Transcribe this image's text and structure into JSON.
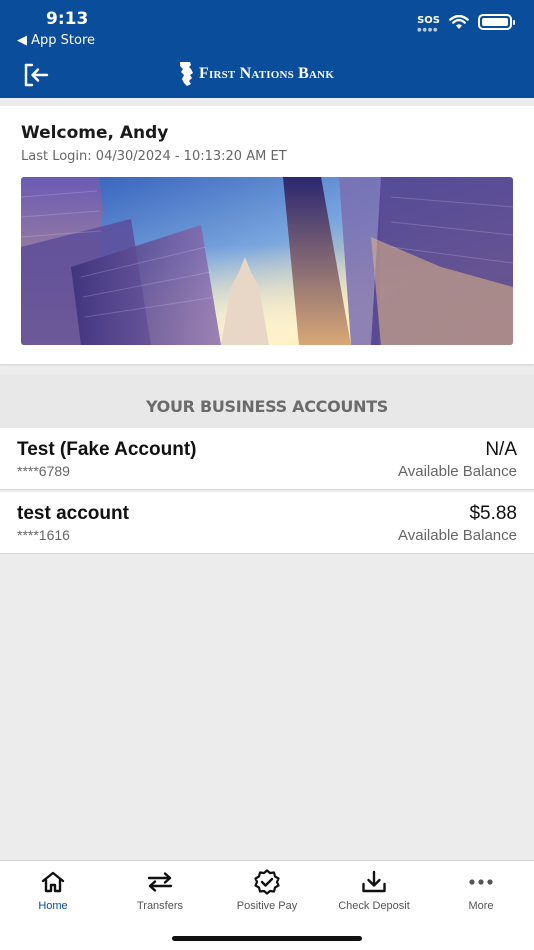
{
  "status_bar": {
    "time": "9:13",
    "back_app": "◀ App Store",
    "sos": "SOS"
  },
  "header": {
    "brand_name": "First Nations Bank",
    "logout_icon": "logout-icon",
    "brand_color": "#0a4e9b"
  },
  "welcome": {
    "title": "Welcome, Andy",
    "last_login": "Last Login: 04/30/2024 - 10:13:20 AM ET"
  },
  "accounts": {
    "section_title": "YOUR BUSINESS ACCOUNTS",
    "items": [
      {
        "name": "Test (Fake Account)",
        "number": "****6789",
        "balance": "N/A",
        "balance_label": "Available Balance"
      },
      {
        "name": "test account",
        "number": "****1616",
        "balance": "$5.88",
        "balance_label": "Available Balance"
      }
    ]
  },
  "tabs": [
    {
      "label": "Home",
      "icon": "home-icon",
      "active": true
    },
    {
      "label": "Transfers",
      "icon": "transfers-icon",
      "active": false
    },
    {
      "label": "Positive Pay",
      "icon": "positive-pay-icon",
      "active": false
    },
    {
      "label": "Check Deposit",
      "icon": "check-deposit-icon",
      "active": false
    },
    {
      "label": "More",
      "icon": "more-icon",
      "active": false
    }
  ]
}
